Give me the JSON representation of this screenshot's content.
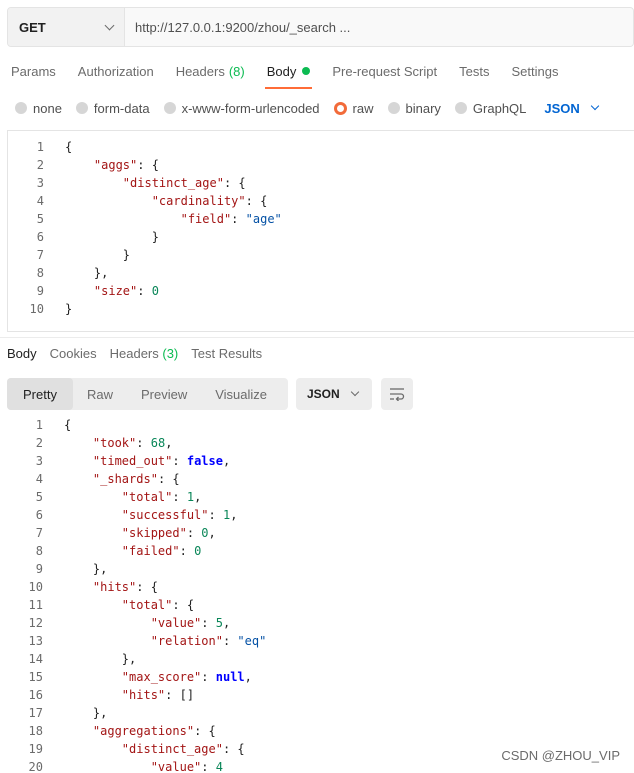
{
  "request": {
    "method": "GET",
    "url": "http://127.0.0.1:9200/zhou/_search ..."
  },
  "request_tabs": [
    {
      "label": "Params"
    },
    {
      "label": "Authorization"
    },
    {
      "label": "Headers",
      "count": "(8)"
    },
    {
      "label": "Body"
    },
    {
      "label": "Pre-request Script"
    },
    {
      "label": "Tests"
    },
    {
      "label": "Settings"
    }
  ],
  "body_types": {
    "options": [
      "none",
      "form-data",
      "x-www-form-urlencoded",
      "raw",
      "binary",
      "GraphQL"
    ],
    "selected": "raw",
    "language": "JSON"
  },
  "request_body_lines": [
    {
      "n": "1",
      "text": "{"
    },
    {
      "n": "2",
      "text": "    \"aggs\": {"
    },
    {
      "n": "3",
      "text": "        \"distinct_age\": {"
    },
    {
      "n": "4",
      "text": "            \"cardinality\": {"
    },
    {
      "n": "5",
      "text": "                \"field\": \"age\""
    },
    {
      "n": "6",
      "text": "            }"
    },
    {
      "n": "7",
      "text": "        }"
    },
    {
      "n": "8",
      "text": "    },"
    },
    {
      "n": "9",
      "text": "    \"size\": 0"
    },
    {
      "n": "10",
      "text": "}"
    }
  ],
  "response_tabs": [
    {
      "label": "Body"
    },
    {
      "label": "Cookies"
    },
    {
      "label": "Headers",
      "count": "(3)"
    },
    {
      "label": "Test Results"
    }
  ],
  "view_modes": [
    "Pretty",
    "Raw",
    "Preview",
    "Visualize"
  ],
  "response_format": "JSON",
  "response_lines": [
    {
      "n": "1",
      "text": "{"
    },
    {
      "n": "2",
      "text": "    \"took\": 68,"
    },
    {
      "n": "3",
      "text": "    \"timed_out\": false,"
    },
    {
      "n": "4",
      "text": "    \"_shards\": {"
    },
    {
      "n": "5",
      "text": "        \"total\": 1,"
    },
    {
      "n": "6",
      "text": "        \"successful\": 1,"
    },
    {
      "n": "7",
      "text": "        \"skipped\": 0,"
    },
    {
      "n": "8",
      "text": "        \"failed\": 0"
    },
    {
      "n": "9",
      "text": "    },"
    },
    {
      "n": "10",
      "text": "    \"hits\": {"
    },
    {
      "n": "11",
      "text": "        \"total\": {"
    },
    {
      "n": "12",
      "text": "            \"value\": 5,"
    },
    {
      "n": "13",
      "text": "            \"relation\": \"eq\""
    },
    {
      "n": "14",
      "text": "        },"
    },
    {
      "n": "15",
      "text": "        \"max_score\": null,"
    },
    {
      "n": "16",
      "text": "        \"hits\": []"
    },
    {
      "n": "17",
      "text": "    },"
    },
    {
      "n": "18",
      "text": "    \"aggregations\": {"
    },
    {
      "n": "19",
      "text": "        \"distinct_age\": {"
    },
    {
      "n": "20",
      "text": "            \"value\": 4"
    }
  ],
  "watermark": "CSDN @ZHOU_VIP",
  "colors": {
    "accent": "#ff6c37",
    "green": "#0cbb52",
    "link_blue": "#0265d2",
    "json_key": "#a31515",
    "json_string": "#0451a5",
    "json_number": "#098658",
    "json_keyword": "#0000ff"
  }
}
